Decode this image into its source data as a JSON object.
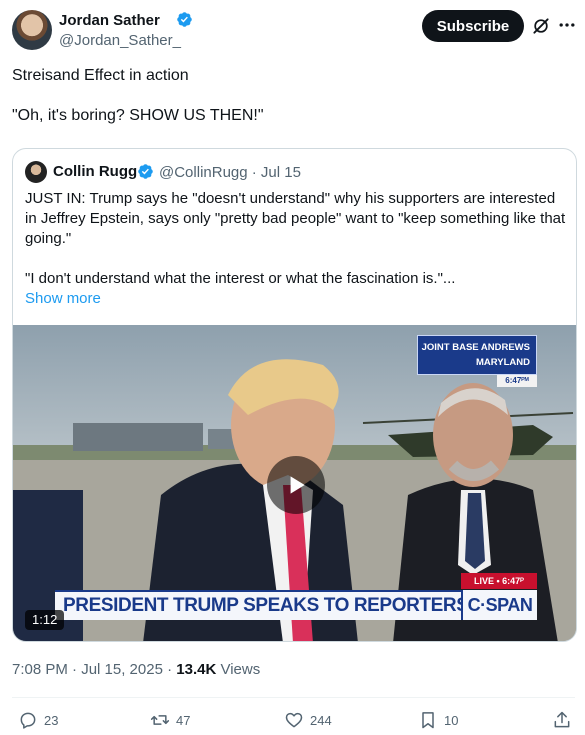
{
  "author": {
    "name": "Jordan Sather",
    "handle": "@Jordan_Sather_",
    "subscribe_label": "Subscribe"
  },
  "tweet": {
    "line1": "Streisand Effect in action",
    "line2": "\"Oh, it's boring? SHOW US THEN!\""
  },
  "quote": {
    "name": "Collin Rugg",
    "meta": "@CollinRugg · Jul 15",
    "body1": "JUST IN: Trump says he \"doesn't understand\" why his supporters are interested in Jeffrey Epstein, says only \"pretty bad people\" want to \"keep something like that going.\"",
    "body2": "\"I don't understand what the interest or what the fascination is.\"...",
    "show_more": "Show more",
    "video": {
      "location_line1": "JOINT BASE ANDREWS",
      "location_line2": "MARYLAND",
      "time_tag": "6:47ᴾᴹ",
      "live_tag": "LIVE • 6:47ᴾ",
      "chyron": "PRESIDENT TRUMP SPEAKS TO REPORTERS",
      "network": "C·SPAN",
      "duration": "1:12"
    }
  },
  "timestamp": {
    "date": "7:08 PM · Jul 15, 2025 · ",
    "views_count": "13.4K",
    "views_label": " Views"
  },
  "actions": {
    "replies": "23",
    "reposts": "47",
    "likes": "244",
    "bookmarks": "10"
  },
  "colors": {
    "accent": "#1d9bf0",
    "text_secondary": "#536471",
    "cspan_blue": "#1a3a8a"
  }
}
